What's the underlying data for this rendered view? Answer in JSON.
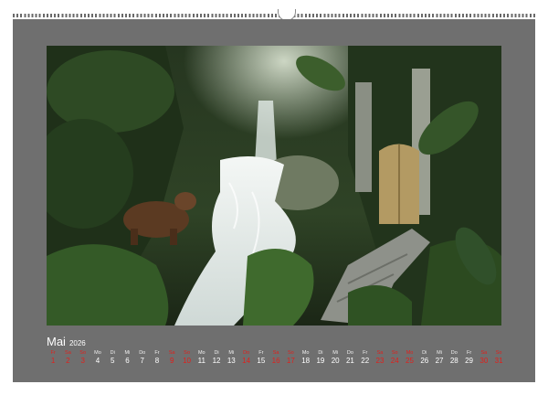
{
  "calendar": {
    "month": "Mai",
    "year": "2026",
    "days": [
      {
        "dn": "Fr",
        "d": "1",
        "red": true
      },
      {
        "dn": "Sa",
        "d": "2",
        "red": true
      },
      {
        "dn": "So",
        "d": "3",
        "red": true
      },
      {
        "dn": "Mo",
        "d": "4",
        "red": false
      },
      {
        "dn": "Di",
        "d": "5",
        "red": false
      },
      {
        "dn": "Mi",
        "d": "6",
        "red": false
      },
      {
        "dn": "Do",
        "d": "7",
        "red": false
      },
      {
        "dn": "Fr",
        "d": "8",
        "red": false
      },
      {
        "dn": "Sa",
        "d": "9",
        "red": true
      },
      {
        "dn": "So",
        "d": "10",
        "red": true
      },
      {
        "dn": "Mo",
        "d": "11",
        "red": false
      },
      {
        "dn": "Di",
        "d": "12",
        "red": false
      },
      {
        "dn": "Mi",
        "d": "13",
        "red": false
      },
      {
        "dn": "Do",
        "d": "14",
        "red": true
      },
      {
        "dn": "Fr",
        "d": "15",
        "red": false
      },
      {
        "dn": "Sa",
        "d": "16",
        "red": true
      },
      {
        "dn": "So",
        "d": "17",
        "red": true
      },
      {
        "dn": "Mo",
        "d": "18",
        "red": false
      },
      {
        "dn": "Di",
        "d": "19",
        "red": false
      },
      {
        "dn": "Mi",
        "d": "20",
        "red": false
      },
      {
        "dn": "Do",
        "d": "21",
        "red": false
      },
      {
        "dn": "Fr",
        "d": "22",
        "red": false
      },
      {
        "dn": "Sa",
        "d": "23",
        "red": true
      },
      {
        "dn": "So",
        "d": "24",
        "red": true
      },
      {
        "dn": "Mo",
        "d": "25",
        "red": true
      },
      {
        "dn": "Di",
        "d": "26",
        "red": false
      },
      {
        "dn": "Mi",
        "d": "27",
        "red": false
      },
      {
        "dn": "Do",
        "d": "28",
        "red": false
      },
      {
        "dn": "Fr",
        "d": "29",
        "red": false
      },
      {
        "dn": "Sa",
        "d": "30",
        "red": true
      },
      {
        "dn": "So",
        "d": "31",
        "red": true
      }
    ]
  },
  "colors": {
    "page_background": "#6f6f6f",
    "holiday_red": "#e0201c",
    "text": "#ffffff"
  },
  "photo": {
    "subject": "fantasy forest with waterfall, bear and wooden door"
  }
}
